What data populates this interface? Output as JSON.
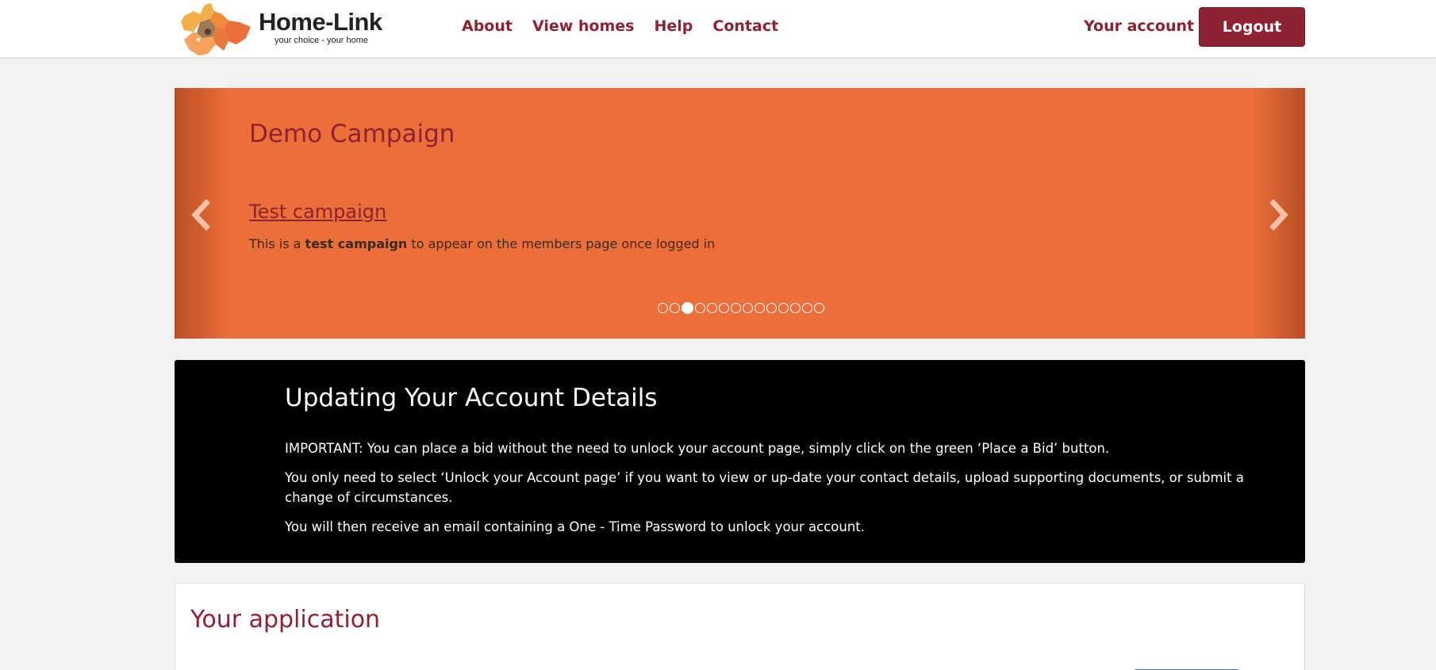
{
  "header": {
    "logo": {
      "name": "Home-Link",
      "tagline": "your choice - your home"
    },
    "nav": [
      {
        "label": "About"
      },
      {
        "label": "View homes"
      },
      {
        "label": "Help"
      },
      {
        "label": "Contact"
      }
    ],
    "account_label": "Your account",
    "logout_label": "Logout"
  },
  "carousel": {
    "background_color": "#ec6f39",
    "title": "Demo Campaign",
    "link_text": "Test campaign",
    "desc_before": "This is a ",
    "desc_bold": "test campaign",
    "desc_after": " to appear on the members page once logged in",
    "slide_count": 14,
    "active_slide": 3,
    "prev_icon": "chevron-left-icon",
    "next_icon": "chevron-right-icon"
  },
  "info": {
    "title": "Updating Your Account Details",
    "p1": "IMPORTANT: You can place a bid without the need to unlock your account page, simply click on the green ‘Place a Bid’ button.",
    "p2": "You only need to select ‘Unlock your Account page’ if you want to view or up-date your contact details, upload supporting documents, or submit a change of circumstances.",
    "p3": "You will then receive an email containing a One - Time Password to unlock your account."
  },
  "application": {
    "title": "Your application"
  },
  "colors": {
    "brand": "#8e2233",
    "carousel": "#ec6f39",
    "info_bg": "#000000",
    "page_bg": "#f2f2f2"
  }
}
